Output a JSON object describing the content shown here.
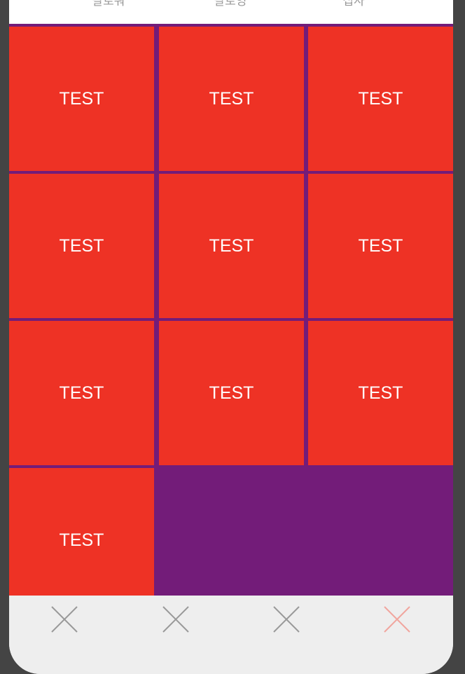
{
  "top_tabs": {
    "followers": "팔로워",
    "following": "팔로잉",
    "extra": "십사"
  },
  "grid": {
    "items": [
      "TEST",
      "TEST",
      "TEST",
      "TEST",
      "TEST",
      "TEST",
      "TEST",
      "TEST",
      "TEST",
      "TEST"
    ]
  },
  "tabbar": {
    "icons": [
      "close-icon",
      "close-icon",
      "close-icon",
      "close-icon"
    ],
    "icon_color": "#999999",
    "active_icon_color": "#f1a59e"
  },
  "colors": {
    "cell": "#ee3225",
    "grid_background": "#731c79",
    "tabbar_background": "#eeeeee",
    "outer_background": "#444444"
  }
}
